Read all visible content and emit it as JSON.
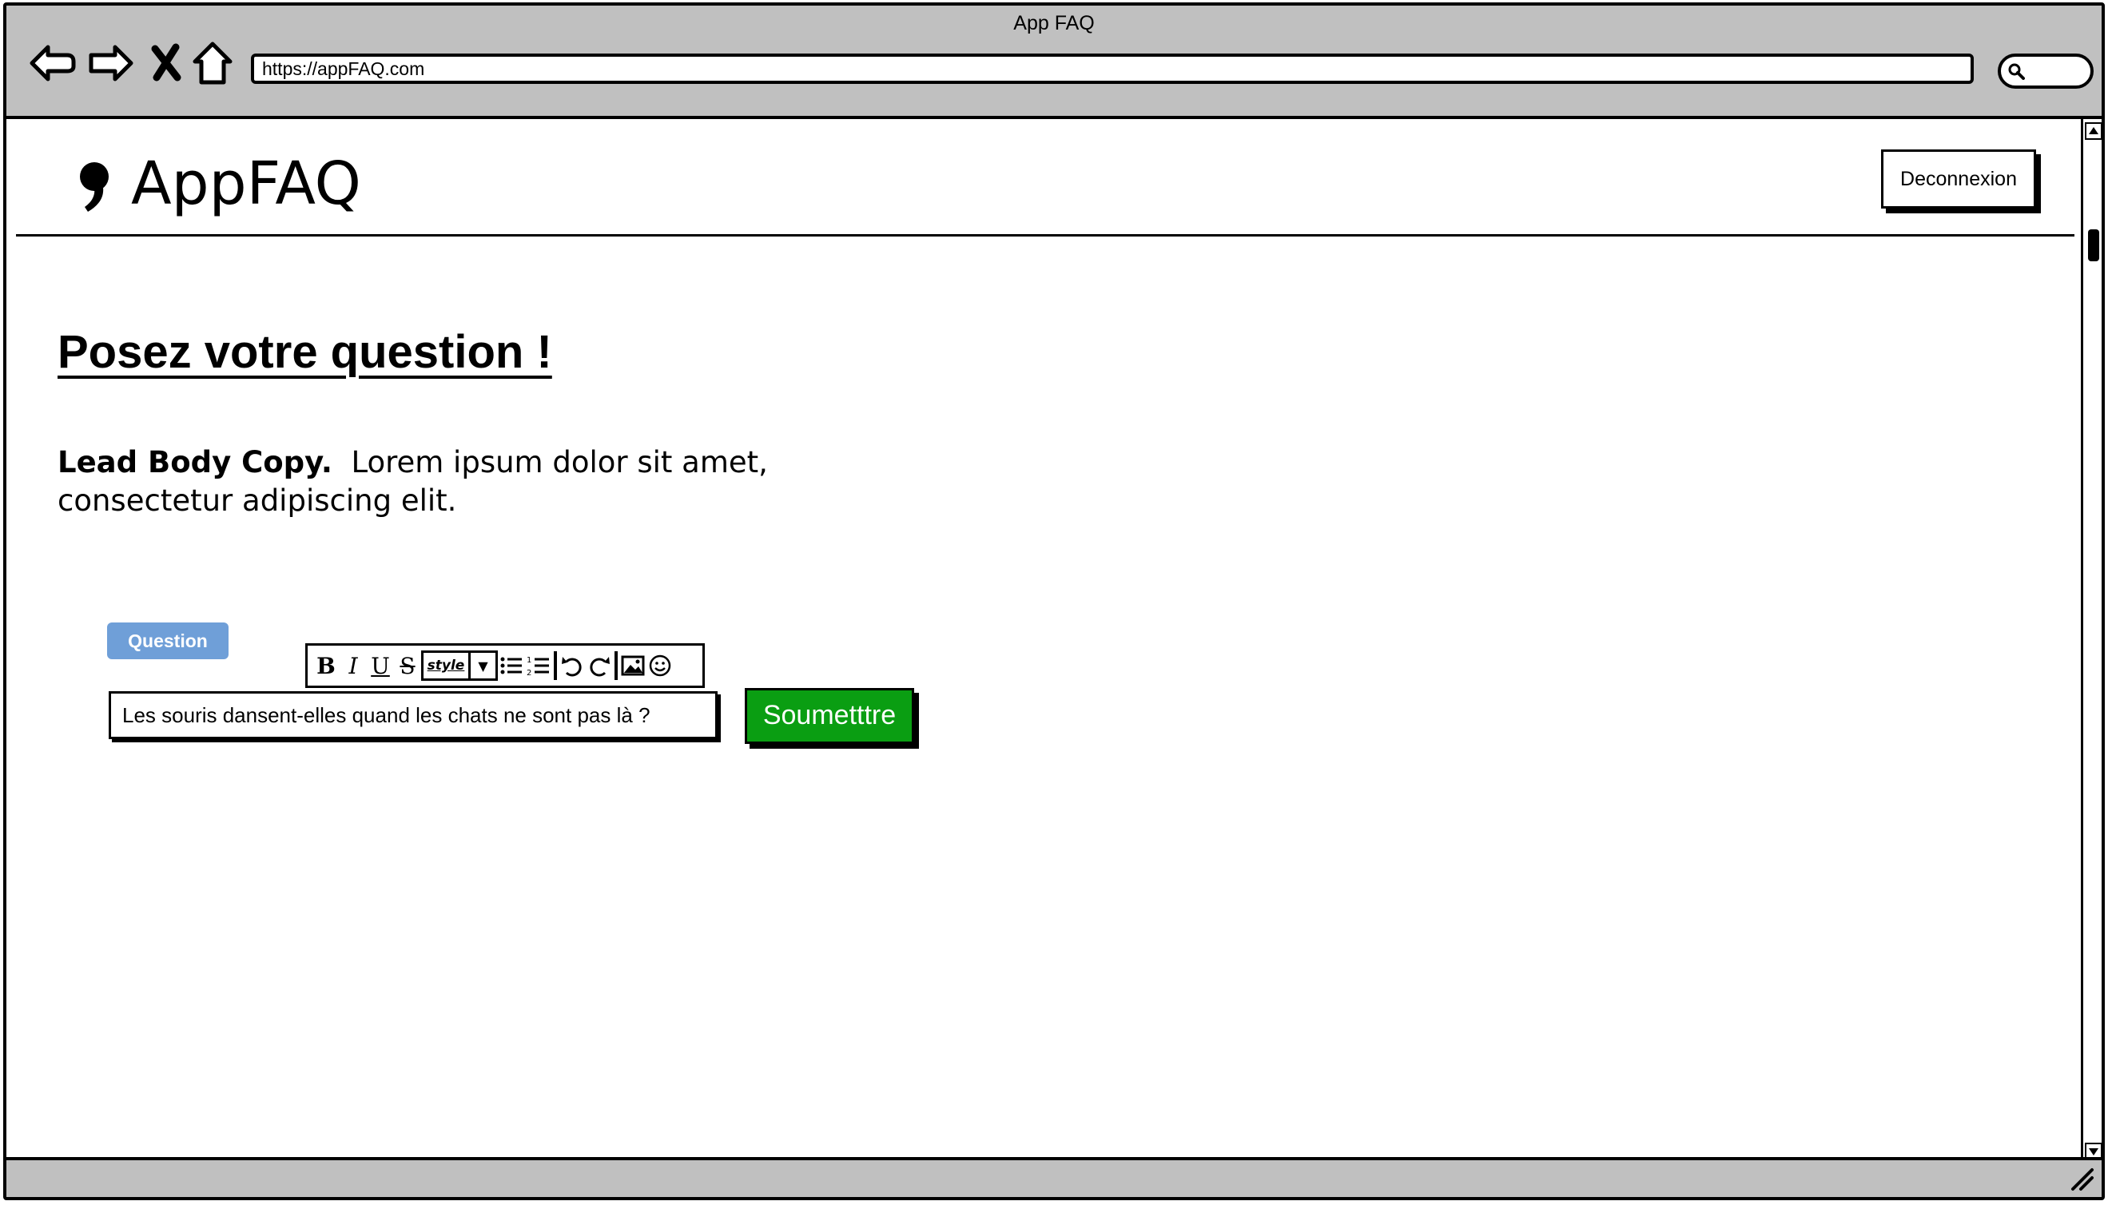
{
  "browser": {
    "window_title": "App FAQ",
    "url": "https://appFAQ.com",
    "nav_icons": [
      "back-icon",
      "forward-icon",
      "close-icon",
      "home-icon"
    ],
    "search_icon": "search-icon"
  },
  "header": {
    "logo_icon": "quote-icon",
    "app_name": "AppFAQ",
    "logout_label": "Deconnexion"
  },
  "main": {
    "title": "Posez votre question !",
    "lead_bold": "Lead Body Copy.",
    "lead_text": "Lorem ipsum dolor sit amet, consectetur adipiscing elit."
  },
  "form": {
    "question_label": "Question",
    "question_value": "Les souris dansent-elles quand les chats ne sont pas là ?",
    "submit_label": "Soumetttre",
    "toolbar": {
      "bold": "B",
      "italic": "I",
      "underline": "U",
      "strike": "S",
      "style": "style"
    }
  },
  "colors": {
    "chrome": "#c0c0c0",
    "label_blue": "#6f9fd8",
    "submit_green": "#0a9e12"
  }
}
